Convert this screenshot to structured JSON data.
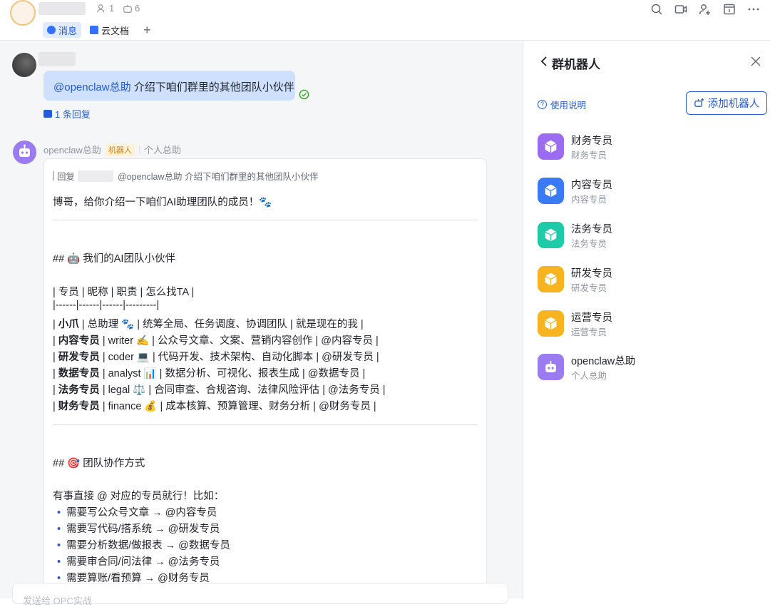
{
  "header": {
    "member_count": "1",
    "bot_count": "6",
    "tabs": [
      {
        "label": "消息"
      },
      {
        "label": "云文档"
      }
    ],
    "add_tab": "+"
  },
  "thread": {
    "user_message_mention": "@openclaw总助",
    "user_message_text": " 介绍下咱们群里的其他团队小伙伴",
    "reply_count": "1 条回复"
  },
  "bot_message": {
    "sender": "openclaw总助",
    "tag": "机器人",
    "subtitle": "个人总助",
    "quote_prefix": "回复",
    "quote_text": "@openclaw总助 介绍下咱们群里的其他团队小伙伴",
    "greeting": "博哥，给你介绍一下咱们AI助理团队的成员！🐾",
    "section1_title": "## 🤖 我们的AI团队小伙伴",
    "table_header": "| 专员 | 昵称 | 职责 | 怎么找TA |",
    "table_sep": "|------|------|------|---------|",
    "rows": [
      {
        "name": "小爪",
        "rest": " | 总助理 🐾 | 统筹全局、任务调度、协调团队 | 就是现在的我 |"
      },
      {
        "name": "内容专员",
        "rest": " | writer ✍️ | 公众号文章、文案、营销内容创作 | @内容专员 |"
      },
      {
        "name": "研发专员",
        "rest": " | coder 💻 | 代码开发、技术架构、自动化脚本 | @研发专员 |"
      },
      {
        "name": "数据专员",
        "rest": " | analyst 📊 | 数据分析、可视化、报表生成 | @数据专员 |"
      },
      {
        "name": "法务专员",
        "rest": " | legal ⚖️ | 合同审查、合规咨询、法律风险评估 | @法务专员 |"
      },
      {
        "name": "财务专员",
        "rest": " | finance 💰 | 成本核算、预算管理、财务分析 | @财务专员 |"
      }
    ],
    "section2_title": "## 🎯 团队协作方式",
    "intro": "有事直接 @ 对应的专员就行！比如：",
    "bullets": [
      "需要写公众号文章 → @内容专员",
      "需要写代码/搭系统 → @研发专员",
      "需要分析数据/做报表 → @数据专员",
      "需要审合同/问法律 → @法务专员",
      "需要算账/看预算 → @财务专员"
    ]
  },
  "composer": {
    "placeholder": "发送给 OPC实战"
  },
  "panel": {
    "title": "群机器人",
    "help": "使用说明",
    "add_button": "添加机器人",
    "bots": [
      {
        "name": "财务专员",
        "desc": "财务专员",
        "color": "#9b6cf2"
      },
      {
        "name": "内容专员",
        "desc": "内容专员",
        "color": "#3a7af5"
      },
      {
        "name": "法务专员",
        "desc": "法务专员",
        "color": "#1fcaa8"
      },
      {
        "name": "研发专员",
        "desc": "研发专员",
        "color": "#f8b320"
      },
      {
        "name": "运营专员",
        "desc": "运营专员",
        "color": "#f8b320"
      },
      {
        "name": "openclaw总助",
        "desc": "个人总助",
        "color": "#9b7cf0"
      }
    ]
  }
}
